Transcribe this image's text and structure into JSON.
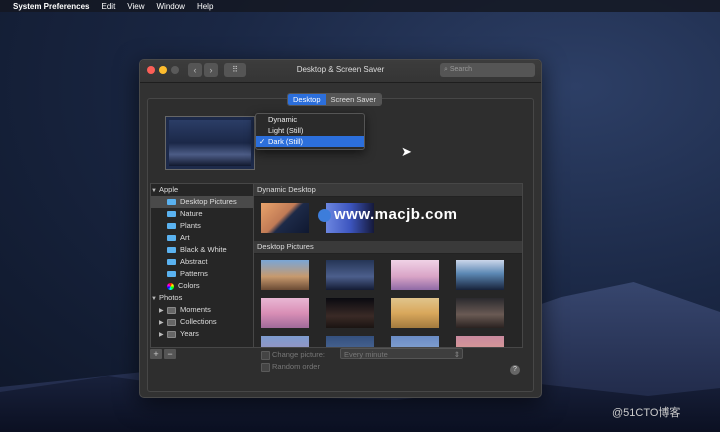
{
  "menubar": {
    "apple": "",
    "app": "System Preferences",
    "items": [
      "Edit",
      "View",
      "Window",
      "Help"
    ]
  },
  "window": {
    "title": "Desktop & Screen Saver",
    "search_placeholder": "Search",
    "back": "‹",
    "forward": "›",
    "grid": "⠿"
  },
  "tabs": [
    {
      "label": "Desktop",
      "active": true
    },
    {
      "label": "Screen Saver",
      "active": false
    }
  ],
  "dropdown": {
    "options": [
      {
        "label": "Dynamic",
        "selected": false
      },
      {
        "label": "Light (Still)",
        "selected": false
      },
      {
        "label": "Dark (Still)",
        "selected": true
      }
    ],
    "check": "✓"
  },
  "sidebar": {
    "apple_group": "Apple",
    "apple_items": [
      "Desktop Pictures",
      "Nature",
      "Plants",
      "Art",
      "Black & White",
      "Abstract",
      "Patterns",
      "Colors"
    ],
    "photos_group": "Photos",
    "photos_items": [
      "Moments",
      "Collections",
      "Years"
    ]
  },
  "content": {
    "section1": "Dynamic Desktop",
    "section2": "Desktop Pictures"
  },
  "bottom": {
    "add": "+",
    "remove": "−",
    "change_picture": "Change picture:",
    "interval": "Every minute",
    "random_order": "Random order",
    "help": "?"
  },
  "watermark": "www.macjb.com",
  "corner_watermark": "@51CTO博客"
}
